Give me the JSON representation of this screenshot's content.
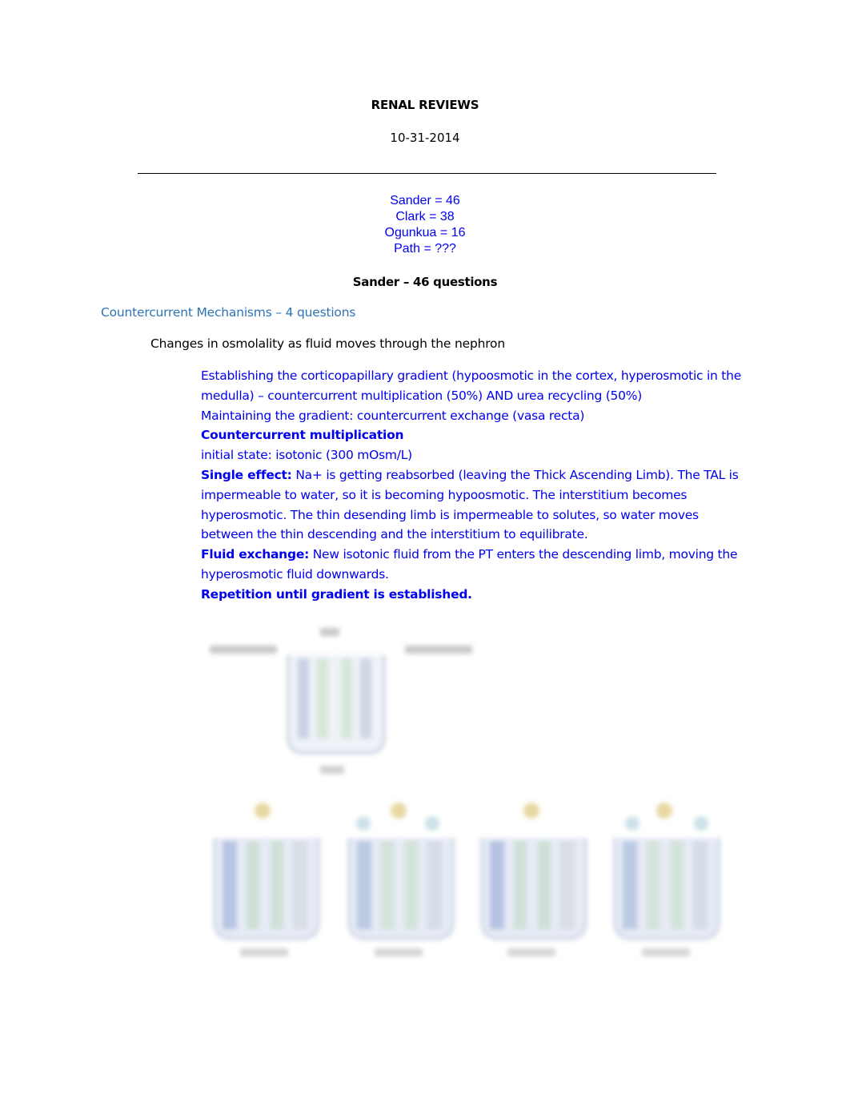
{
  "document": {
    "title": "RENAL REVIEWS",
    "date": "10-31-2014",
    "divider": "horizontal-rule",
    "question_counts": [
      "Sander = 46",
      "Clark = 38",
      "Ogunkua = 16",
      "Path = ???"
    ],
    "section_title": "Sander – 46 questions",
    "subsection_title": "Countercurrent Mechanisms – 4 questions",
    "topic": "Changes in osmolality as fluid moves through the nephron",
    "notes": {
      "gradient_establishing": "Establishing the corticopapillary gradient (hypoosmotic in the cortex, hyperosmotic in the medulla) – countercurrent multiplication (50%) AND urea recycling (50%)",
      "gradient_maintaining": "Maintaining the gradient: countercurrent exchange (vasa recta)",
      "cc_multiplication_heading": "Countercurrent multiplication",
      "initial_state": "initial state: isotonic (300 mOsm/L)",
      "single_effect_label": "Single effect:",
      "single_effect_text": " Na+ is getting reabsorbed (leaving the Thick Ascending Limb). The TAL is impermeable to water, so it is becoming hypoosmotic. The interstitium becomes hyperosmotic. The thin desending limb is impermeable to solutes, so water moves between the thin descending and the interstitium to equilibrate.",
      "fluid_exchange_label": "Fluid exchange:",
      "fluid_exchange_text": " New isotonic fluid from the PT enters the descending limb, moving the hyperosmotic fluid downwards.",
      "repetition": "Repetition until gradient is established."
    },
    "figure": {
      "description": "blurred-loop-of-henle-diagram",
      "panels": 5
    }
  }
}
